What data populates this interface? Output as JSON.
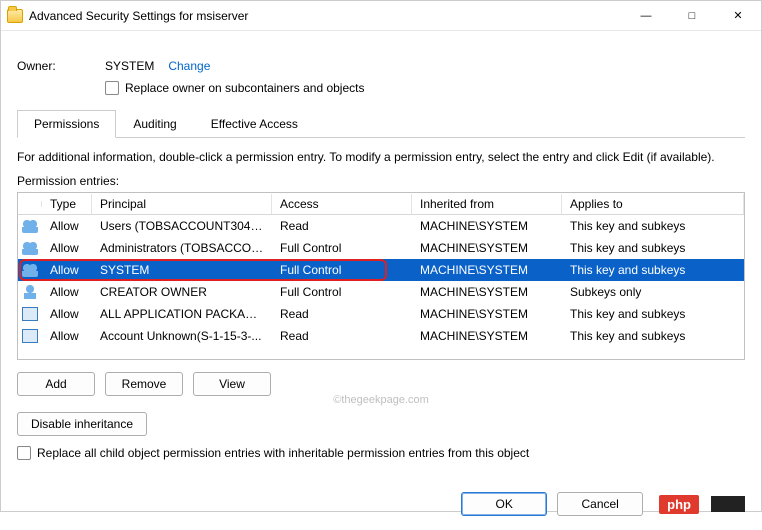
{
  "title": "Advanced Security Settings for msiserver",
  "owner": {
    "label": "Owner:",
    "value": "SYSTEM",
    "change": "Change"
  },
  "replace_owner_label": "Replace owner on subcontainers and objects",
  "tabs": [
    "Permissions",
    "Auditing",
    "Effective Access"
  ],
  "active_tab": 0,
  "info": "For additional information, double-click a permission entry. To modify a permission entry, select the entry and click Edit (if available).",
  "entries_label": "Permission entries:",
  "columns": {
    "type": "Type",
    "principal": "Principal",
    "access": "Access",
    "inherited": "Inherited from",
    "applies": "Applies to"
  },
  "rows": [
    {
      "icon": "users",
      "type": "Allow",
      "principal": "Users (TOBSACCOUNT304\\Us...",
      "access": "Read",
      "inherited": "MACHINE\\SYSTEM",
      "applies": "This key and subkeys",
      "selected": false
    },
    {
      "icon": "users",
      "type": "Allow",
      "principal": "Administrators (TOBSACCOU...",
      "access": "Full Control",
      "inherited": "MACHINE\\SYSTEM",
      "applies": "This key and subkeys",
      "selected": false
    },
    {
      "icon": "users",
      "type": "Allow",
      "principal": "SYSTEM",
      "access": "Full Control",
      "inherited": "MACHINE\\SYSTEM",
      "applies": "This key and subkeys",
      "selected": true
    },
    {
      "icon": "user",
      "type": "Allow",
      "principal": "CREATOR OWNER",
      "access": "Full Control",
      "inherited": "MACHINE\\SYSTEM",
      "applies": "Subkeys only",
      "selected": false
    },
    {
      "icon": "pkg",
      "type": "Allow",
      "principal": "ALL APPLICATION PACKAGES",
      "access": "Read",
      "inherited": "MACHINE\\SYSTEM",
      "applies": "This key and subkeys",
      "selected": false
    },
    {
      "icon": "pkg",
      "type": "Allow",
      "principal": "Account Unknown(S-1-15-3-...",
      "access": "Read",
      "inherited": "MACHINE\\SYSTEM",
      "applies": "This key and subkeys",
      "selected": false
    }
  ],
  "buttons": {
    "add": "Add",
    "remove": "Remove",
    "view": "View",
    "disable_inh": "Disable inheritance"
  },
  "replace_all_label": "Replace all child object permission entries with inheritable permission entries from this object",
  "footer": {
    "ok": "OK",
    "cancel": "Cancel"
  },
  "watermark": "©thegeekpage.com",
  "badge": "php"
}
